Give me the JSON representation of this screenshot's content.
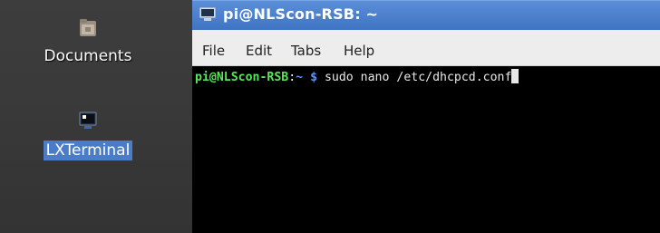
{
  "desktop": {
    "icons": [
      {
        "label": "Documents",
        "icon": "folder-icon",
        "selected": false
      },
      {
        "label": "LXTerminal",
        "icon": "terminal-icon",
        "selected": true
      }
    ]
  },
  "window": {
    "title": "pi@NLScon-RSB: ~",
    "menu": [
      "File",
      "Edit",
      "Tabs",
      "Help"
    ],
    "terminal": {
      "prompt_user": "pi@NLScon-RSB",
      "prompt_colon": ":",
      "prompt_path": "~",
      "prompt_symbol": "$",
      "command": "sudo nano /etc/dhcpcd.conf"
    }
  },
  "colors": {
    "titlebar": "#4a7cc7",
    "selection": "#4a7cc7",
    "prompt_user": "#57e85a",
    "prompt_path": "#5b93ff",
    "terminal_bg": "#000000"
  }
}
